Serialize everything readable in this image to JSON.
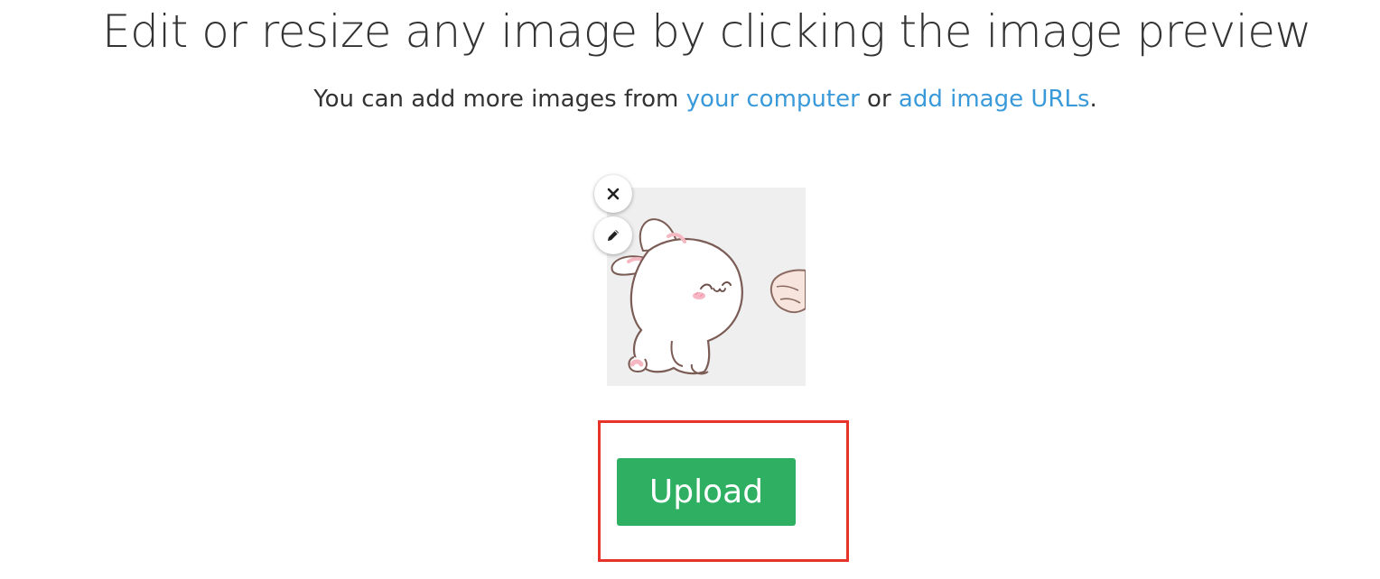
{
  "header": {
    "title": "Edit or resize any image by clicking the image preview"
  },
  "subtitle": {
    "prefix": "You can add more images from ",
    "link_computer": "your computer",
    "middle": " or ",
    "link_urls": "add image URLs",
    "suffix": "."
  },
  "preview": {
    "close_icon": "close-icon",
    "edit_icon": "pencil-icon",
    "background": "#efefef"
  },
  "actions": {
    "upload_label": "Upload"
  },
  "colors": {
    "link": "#3a9ad9",
    "upload_button": "#2faf62",
    "highlight": "#e8332a"
  }
}
